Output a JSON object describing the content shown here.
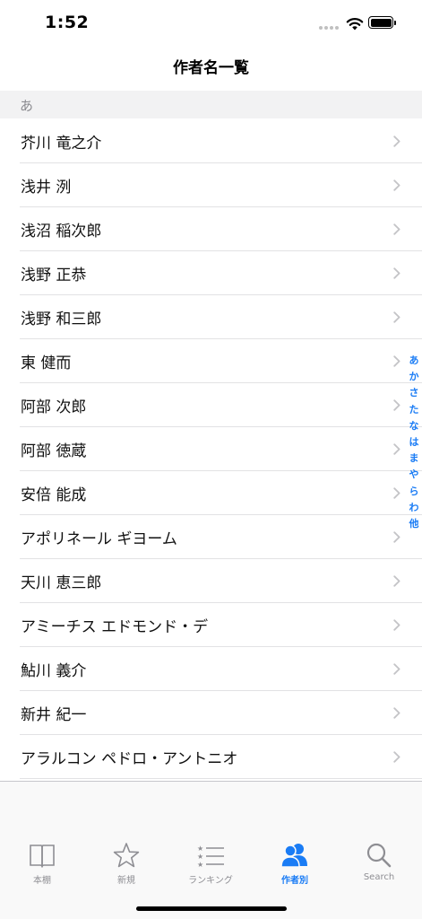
{
  "status_bar": {
    "time": "1:52"
  },
  "nav": {
    "title": "作者名一覧"
  },
  "section": {
    "header": "あ"
  },
  "authors": [
    {
      "name": "芥川 竜之介"
    },
    {
      "name": "浅井 洌"
    },
    {
      "name": "浅沼 稲次郎"
    },
    {
      "name": "浅野 正恭"
    },
    {
      "name": "浅野 和三郎"
    },
    {
      "name": "東 健而"
    },
    {
      "name": "阿部 次郎"
    },
    {
      "name": "阿部 徳蔵"
    },
    {
      "name": "安倍 能成"
    },
    {
      "name": "アポリネール ギヨーム"
    },
    {
      "name": "天川 恵三郎"
    },
    {
      "name": "アミーチス エドモンド・デ"
    },
    {
      "name": "鮎川 義介"
    },
    {
      "name": "新井 紀一"
    },
    {
      "name": "アラルコン ペドロ・アントニオ"
    }
  ],
  "index": [
    "あ",
    "か",
    "さ",
    "た",
    "な",
    "は",
    "ま",
    "や",
    "ら",
    "わ",
    "他"
  ],
  "tabs": [
    {
      "label": "本棚",
      "icon": "book-icon",
      "active": false
    },
    {
      "label": "新規",
      "icon": "star-icon",
      "active": false
    },
    {
      "label": "ランキング",
      "icon": "ranking-list-icon",
      "active": false
    },
    {
      "label": "作者別",
      "icon": "people-icon",
      "active": true
    },
    {
      "label": "Search",
      "icon": "search-icon",
      "active": false
    }
  ],
  "colors": {
    "accent": "#1a7cf5",
    "inactive": "#8e8e93",
    "section_bg": "#f2f2f3"
  }
}
